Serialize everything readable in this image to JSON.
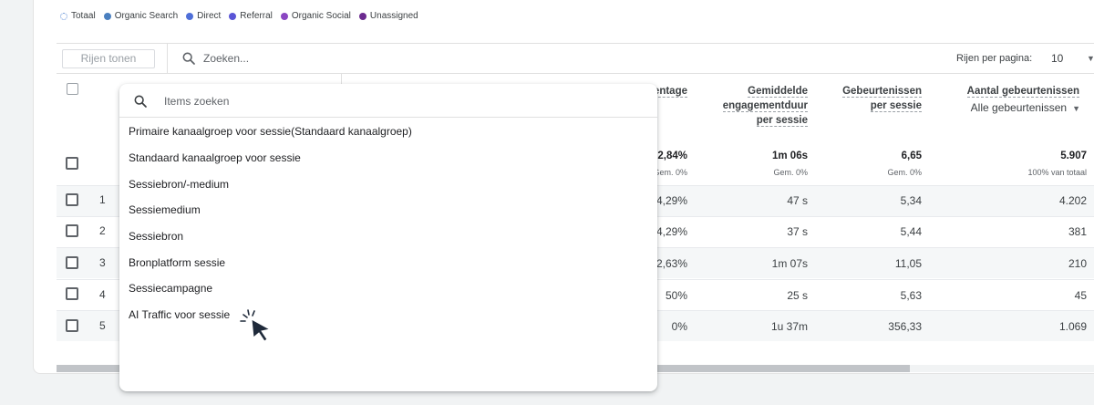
{
  "legend": [
    {
      "label": "Totaal",
      "color": "#ffffff"
    },
    {
      "label": "Organic Search",
      "color": "#4a7fbf"
    },
    {
      "label": "Direct",
      "color": "#4f6fd8"
    },
    {
      "label": "Referral",
      "color": "#5a55d6"
    },
    {
      "label": "Organic Social",
      "color": "#8a46c2"
    },
    {
      "label": "Unassigned",
      "color": "#6b2a8f"
    }
  ],
  "toolbar": {
    "rows_button": "Rijen tonen",
    "search_placeholder": "Zoeken...",
    "rows_per_page_label": "Rijen per pagina:",
    "rows_per_page_value": "10"
  },
  "columns": {
    "percentage": "entage",
    "engagement": [
      "Gemiddelde",
      "engagementduur",
      "per sessie"
    ],
    "events_per_session": [
      "Gebeurtenissen",
      "per sessie"
    ],
    "event_count": "Aantal gebeurtenissen",
    "event_filter": "Alle gebeurtenissen"
  },
  "totals": {
    "percentage": "2,84%",
    "percentage_sub": "Gem. 0%",
    "engagement": "1m 06s",
    "engagement_sub": "Gem. 0%",
    "events_per_session": "6,65",
    "events_per_session_sub": "Gem. 0%",
    "event_count": "5.907",
    "event_count_sub": "100% van totaal"
  },
  "rows": [
    {
      "num": "1",
      "percentage": "4,29%",
      "engagement": "47 s",
      "events_per_session": "5,34",
      "event_count": "4.202"
    },
    {
      "num": "2",
      "percentage": "4,29%",
      "engagement": "37 s",
      "events_per_session": "5,44",
      "event_count": "381"
    },
    {
      "num": "3",
      "percentage": "2,63%",
      "engagement": "1m 07s",
      "events_per_session": "11,05",
      "event_count": "210"
    },
    {
      "num": "4",
      "percentage": "50%",
      "engagement": "25 s",
      "events_per_session": "5,63",
      "event_count": "45"
    },
    {
      "num": "5",
      "percentage": "0%",
      "engagement": "1u 37m",
      "events_per_session": "356,33",
      "event_count": "1.069"
    }
  ],
  "dropdown": {
    "search_placeholder": "Items zoeken",
    "items": [
      "Primaire kanaalgroep voor sessie(Standaard kanaalgroep)",
      "Standaard kanaalgroep voor sessie",
      "Sessiebron/-medium",
      "Sessiemedium",
      "Sessiebron",
      "Bronplatform sessie",
      "Sessiecampagne",
      "AI Traffic voor sessie"
    ]
  }
}
